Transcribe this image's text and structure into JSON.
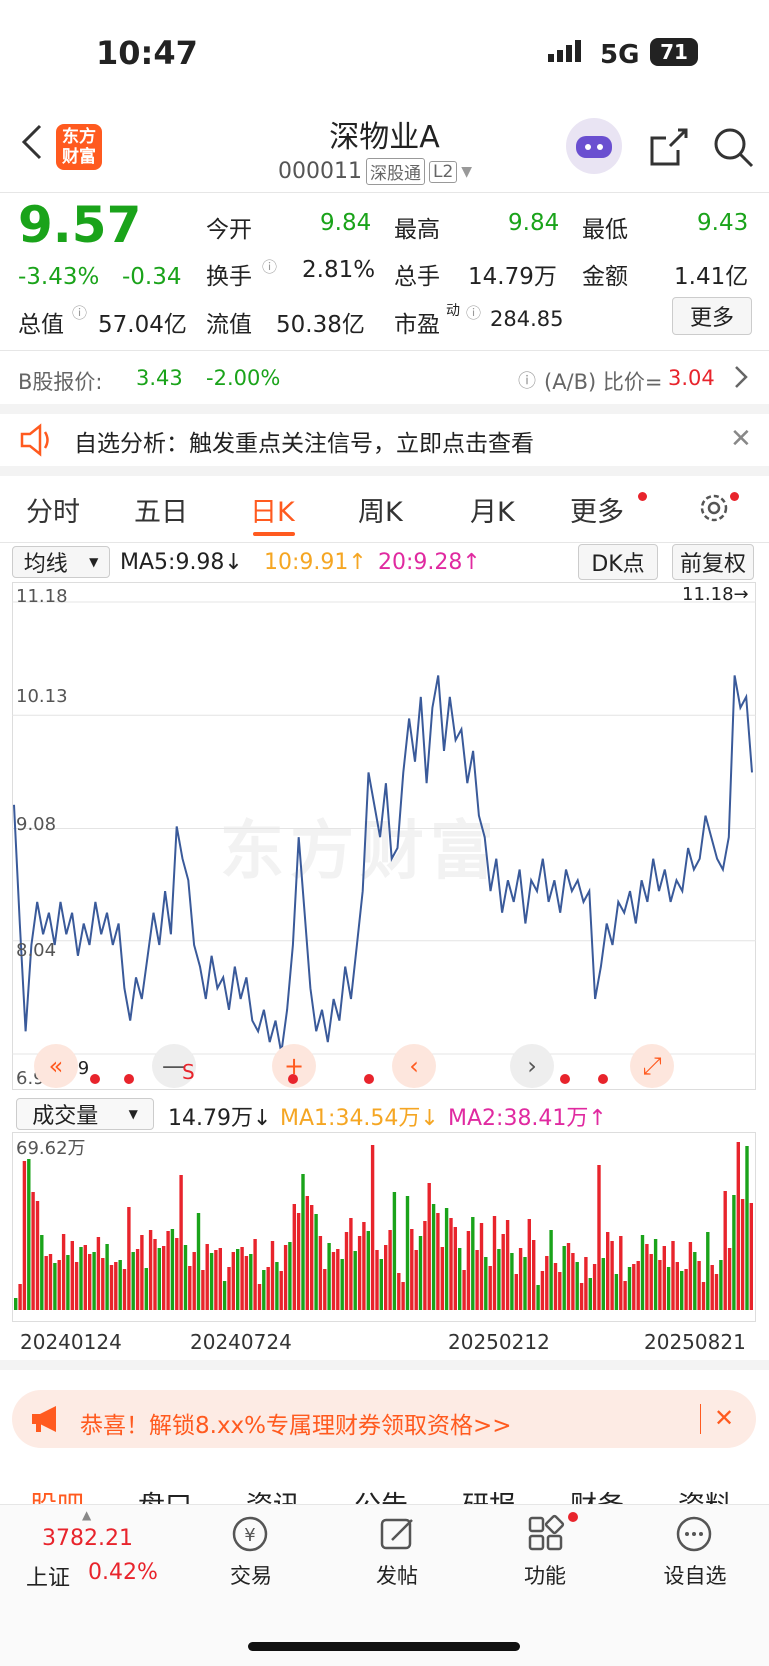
{
  "status": {
    "time": "10:47",
    "network": "5G",
    "battery": "71"
  },
  "header": {
    "title": "深物业A",
    "code": "000011",
    "market_tag": "深股通",
    "level_tag": "L2",
    "logo_text": "东方财富"
  },
  "quote": {
    "price": "9.57",
    "change_pct": "-3.43%",
    "change": "-0.34",
    "open_label": "今开",
    "open": "9.84",
    "high_label": "最高",
    "high": "9.84",
    "low_label": "最低",
    "low": "9.43",
    "turnover_label": "换手",
    "turnover": "2.81%",
    "volume_label": "总手",
    "volume": "14.79万",
    "amount_label": "金额",
    "amount": "1.41亿",
    "mktcap_label": "总值",
    "mktcap": "57.04亿",
    "float_label": "流值",
    "float": "50.38亿",
    "pe_label": "市盈",
    "pe_sup": "动",
    "pe": "284.85",
    "more_button": "更多"
  },
  "b_share": {
    "label": "B股报价:",
    "price": "3.43",
    "change": "-2.00%",
    "ratio_label": "(A/B) 比价=",
    "ratio": "3.04"
  },
  "notice": {
    "text": "自选分析：触发重点关注信号，立即点击查看"
  },
  "tabs": [
    "分时",
    "五日",
    "日K",
    "周K",
    "月K",
    "更多"
  ],
  "active_tab": "日K",
  "legend": {
    "selector": "均线",
    "ma5": "MA5:9.98↓",
    "ma10": "10:9.91↑",
    "ma20": "20:9.28↑",
    "dk": "DK点",
    "adjust": "前复权"
  },
  "price_axis": {
    "top": "11.18",
    "l2": "10.13",
    "l3": "9.08",
    "l4": "8.04",
    "bottom": "6.99",
    "max_marker": "11.18→",
    "min_marker": "←6.99"
  },
  "volume": {
    "selector": "成交量",
    "value": "14.79万↓",
    "ma1": "MA1:34.54万↓",
    "ma2": "MA2:38.41万↑",
    "max_label": "69.62万"
  },
  "dates": [
    "20240124",
    "20240724",
    "20250212",
    "20250821"
  ],
  "promo": {
    "text": "恭喜！解锁8.xx%专属理财券领取资格>>"
  },
  "sub_tabs": [
    "股吧",
    "盘口",
    "资讯",
    "公告",
    "研报",
    "财务",
    "资料"
  ],
  "bottom_nav": {
    "index_value": "3782.21",
    "index_name": "上证",
    "index_change": "0.42%",
    "trade": "交易",
    "post": "发帖",
    "function": "功能",
    "watchlist": "设自选"
  },
  "colors": {
    "up": "#e8242c",
    "down": "#1aa31a",
    "line": "#3a5a9a",
    "accent": "#ff6a00"
  },
  "chart_data": {
    "type": "line",
    "title": "",
    "ylim": [
      6.99,
      11.18
    ],
    "x_ticks": [
      "20240124",
      "20240724",
      "20250212",
      "20250821"
    ],
    "close": [
      9.3,
      8.2,
      7.2,
      8.0,
      8.4,
      8.1,
      8.3,
      8.0,
      8.4,
      8.1,
      8.3,
      7.9,
      8.2,
      8.0,
      8.4,
      8.1,
      8.3,
      8.0,
      8.2,
      7.6,
      7.3,
      7.7,
      7.5,
      7.9,
      8.3,
      8.0,
      8.5,
      8.1,
      9.1,
      8.8,
      8.6,
      8.0,
      7.8,
      7.5,
      7.9,
      7.6,
      7.7,
      7.4,
      7.8,
      7.5,
      7.7,
      7.3,
      7.2,
      7.4,
      7.1,
      7.3,
      7.0,
      7.4,
      8.0,
      9.0,
      8.3,
      7.6,
      7.2,
      7.4,
      7.1,
      7.5,
      7.3,
      7.8,
      7.5,
      8.0,
      8.5,
      9.6,
      9.3,
      9.0,
      9.5,
      8.8,
      8.9,
      9.6,
      10.1,
      9.7,
      10.3,
      9.5,
      10.2,
      10.5,
      9.8,
      10.3,
      9.9,
      10.0,
      9.5,
      9.8,
      9.2,
      9.0,
      8.5,
      8.8,
      8.3,
      8.6,
      8.4,
      8.7,
      8.2,
      8.6,
      8.5,
      8.8,
      8.4,
      8.6,
      8.3,
      8.7,
      8.5,
      8.6,
      8.4,
      8.5,
      7.5,
      7.8,
      8.2,
      8.0,
      8.4,
      8.3,
      8.5,
      8.2,
      8.6,
      8.4,
      8.8,
      8.5,
      8.7,
      8.4,
      8.6,
      8.5,
      8.9,
      8.7,
      8.8,
      9.2,
      9.0,
      8.8,
      8.7,
      9.0,
      10.5,
      10.2,
      10.3,
      9.6
    ]
  }
}
